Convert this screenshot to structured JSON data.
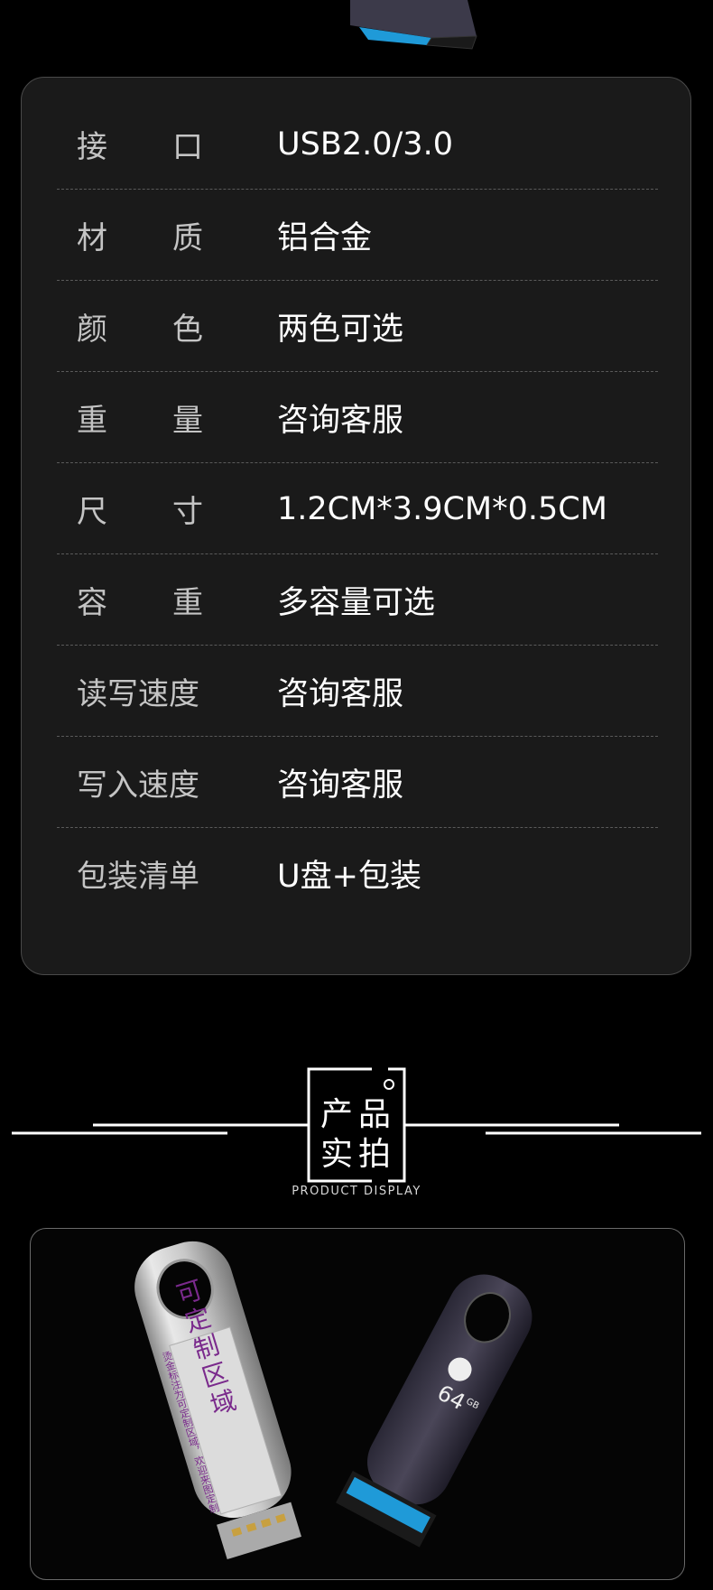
{
  "specs": [
    {
      "label": "接口",
      "value": "USB2.0/3.0"
    },
    {
      "label": "材质",
      "value": "铝合金"
    },
    {
      "label": "颜色",
      "value": "两色可选"
    },
    {
      "label": "重量",
      "value": "咨询客服"
    },
    {
      "label": "尺寸",
      "value": "1.2CM*3.9CM*0.5CM"
    },
    {
      "label": "容重",
      "value": "多容量可选"
    },
    {
      "label": "读写速度",
      "value": "咨询客服"
    },
    {
      "label": "写入速度",
      "value": "咨询客服"
    },
    {
      "label": "包装清单",
      "value": "U盘+包装"
    }
  ],
  "section": {
    "title_line1": "产品",
    "title_line2": "实拍",
    "subtitle": "PRODUCT DISPLAY"
  },
  "photo": {
    "silver_drive_text": "可定制区域",
    "silver_drive_side_text": "烫金标注为可定制区域，欢迎来图定制",
    "dark_drive_capacity": "64",
    "dark_drive_unit": "GB"
  },
  "colors": {
    "background": "#000000",
    "card": "#1a1a1a",
    "accent_blue": "#1e8fd6",
    "purple_text": "#7a2a8c"
  }
}
